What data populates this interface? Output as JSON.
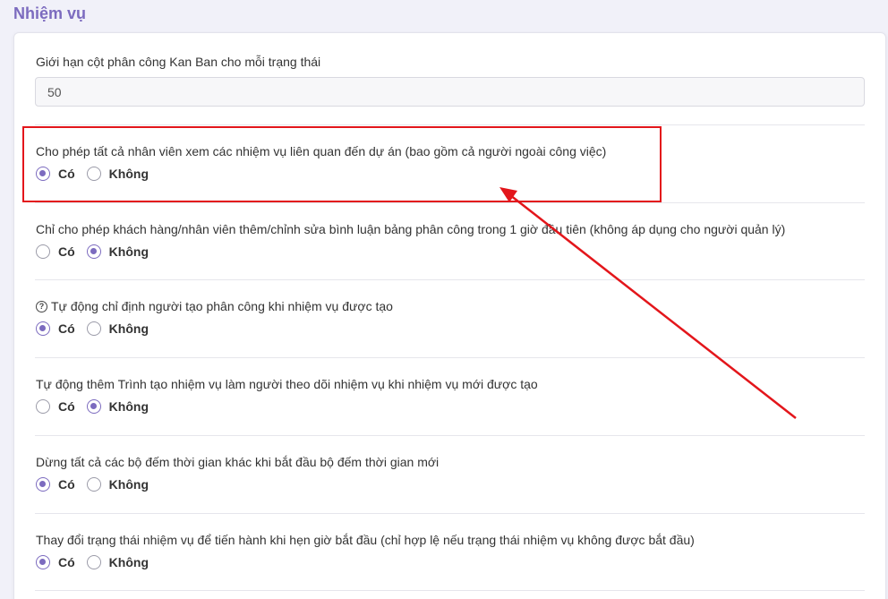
{
  "page": {
    "title": "Nhiệm vụ"
  },
  "kanban": {
    "label": "Giới hạn cột phân công Kan Ban cho mỗi trạng thái",
    "value": "50"
  },
  "radio_labels": {
    "yes": "Có",
    "no": "Không"
  },
  "settings": [
    {
      "label": "Cho phép tất cả nhân viên xem các nhiệm vụ liên quan đến dự án (bao gồm cả người ngoài công việc)",
      "selected": "yes"
    },
    {
      "label": "Chỉ cho phép khách hàng/nhân viên thêm/chỉnh sửa bình luận bảng phân công trong 1 giờ đầu tiên (không áp dụng cho người quản lý)",
      "selected": "no"
    },
    {
      "label": "Tự động chỉ định người tạo phân công khi nhiệm vụ được tạo",
      "selected": "yes",
      "help_icon": "question-circle-icon"
    },
    {
      "label": "Tự động thêm Trình tạo nhiệm vụ làm người theo dõi nhiệm vụ khi nhiệm vụ mới được tạo",
      "selected": "no"
    },
    {
      "label": "Dừng tất cả các bộ đếm thời gian khác khi bắt đầu bộ đếm thời gian mới",
      "selected": "yes"
    },
    {
      "label": "Thay đổi trạng thái nhiệm vụ để tiến hành khi hẹn giờ bắt đầu (chỉ hợp lệ nếu trạng thái nhiệm vụ không được bắt đầu)",
      "selected": "yes"
    }
  ],
  "colors": {
    "accent": "#7c6bbf",
    "annotation": "#e3161b"
  }
}
